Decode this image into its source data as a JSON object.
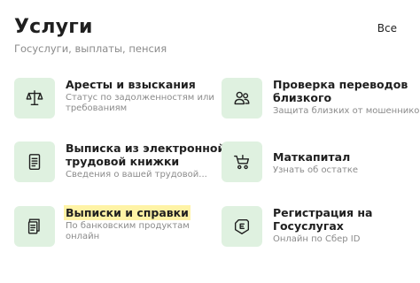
{
  "header": {
    "title": "Услуги",
    "subtitle": "Госуслуги, выплаты, пенсия",
    "all_link": "Все"
  },
  "services": [
    {
      "id": "arrests",
      "icon": "scales-icon",
      "title_lines": [
        "Аресты и взыскания"
      ],
      "desc_lines": [
        "Статус по задолженностям или",
        "требованиям"
      ]
    },
    {
      "id": "transfer-check",
      "icon": "people-icon",
      "title_lines": [
        "Проверка переводов",
        "близкого"
      ],
      "desc_lines": [
        "Защита близких от мошенников"
      ]
    },
    {
      "id": "work-record",
      "icon": "document-icon",
      "title_lines": [
        "Выписка из электронной",
        "трудовой книжки"
      ],
      "desc_lines": [
        "Сведения о вашей трудовой..."
      ]
    },
    {
      "id": "maternity-capital",
      "icon": "stroller-icon",
      "title_lines": [
        "Маткапитал"
      ],
      "desc_lines": [
        "Узнать об остатке"
      ]
    },
    {
      "id": "statements",
      "icon": "documents-icon",
      "title_lines": [
        "Выписки и справки"
      ],
      "desc_lines": [
        "По банковским продуктам",
        "онлайн"
      ],
      "highlight": true
    },
    {
      "id": "gosuslugi-registration",
      "icon": "gosuslugi-logo-icon",
      "title_lines": [
        "Регистрация на",
        "Госуслугах"
      ],
      "desc_lines": [
        "Онлайн по Сбер ID"
      ]
    }
  ],
  "colors": {
    "tile_bg": "#dff1e0",
    "icon_stroke": "#1f1f1f",
    "secondary_text": "#8b8b8b",
    "highlight": "#fff3a6"
  }
}
